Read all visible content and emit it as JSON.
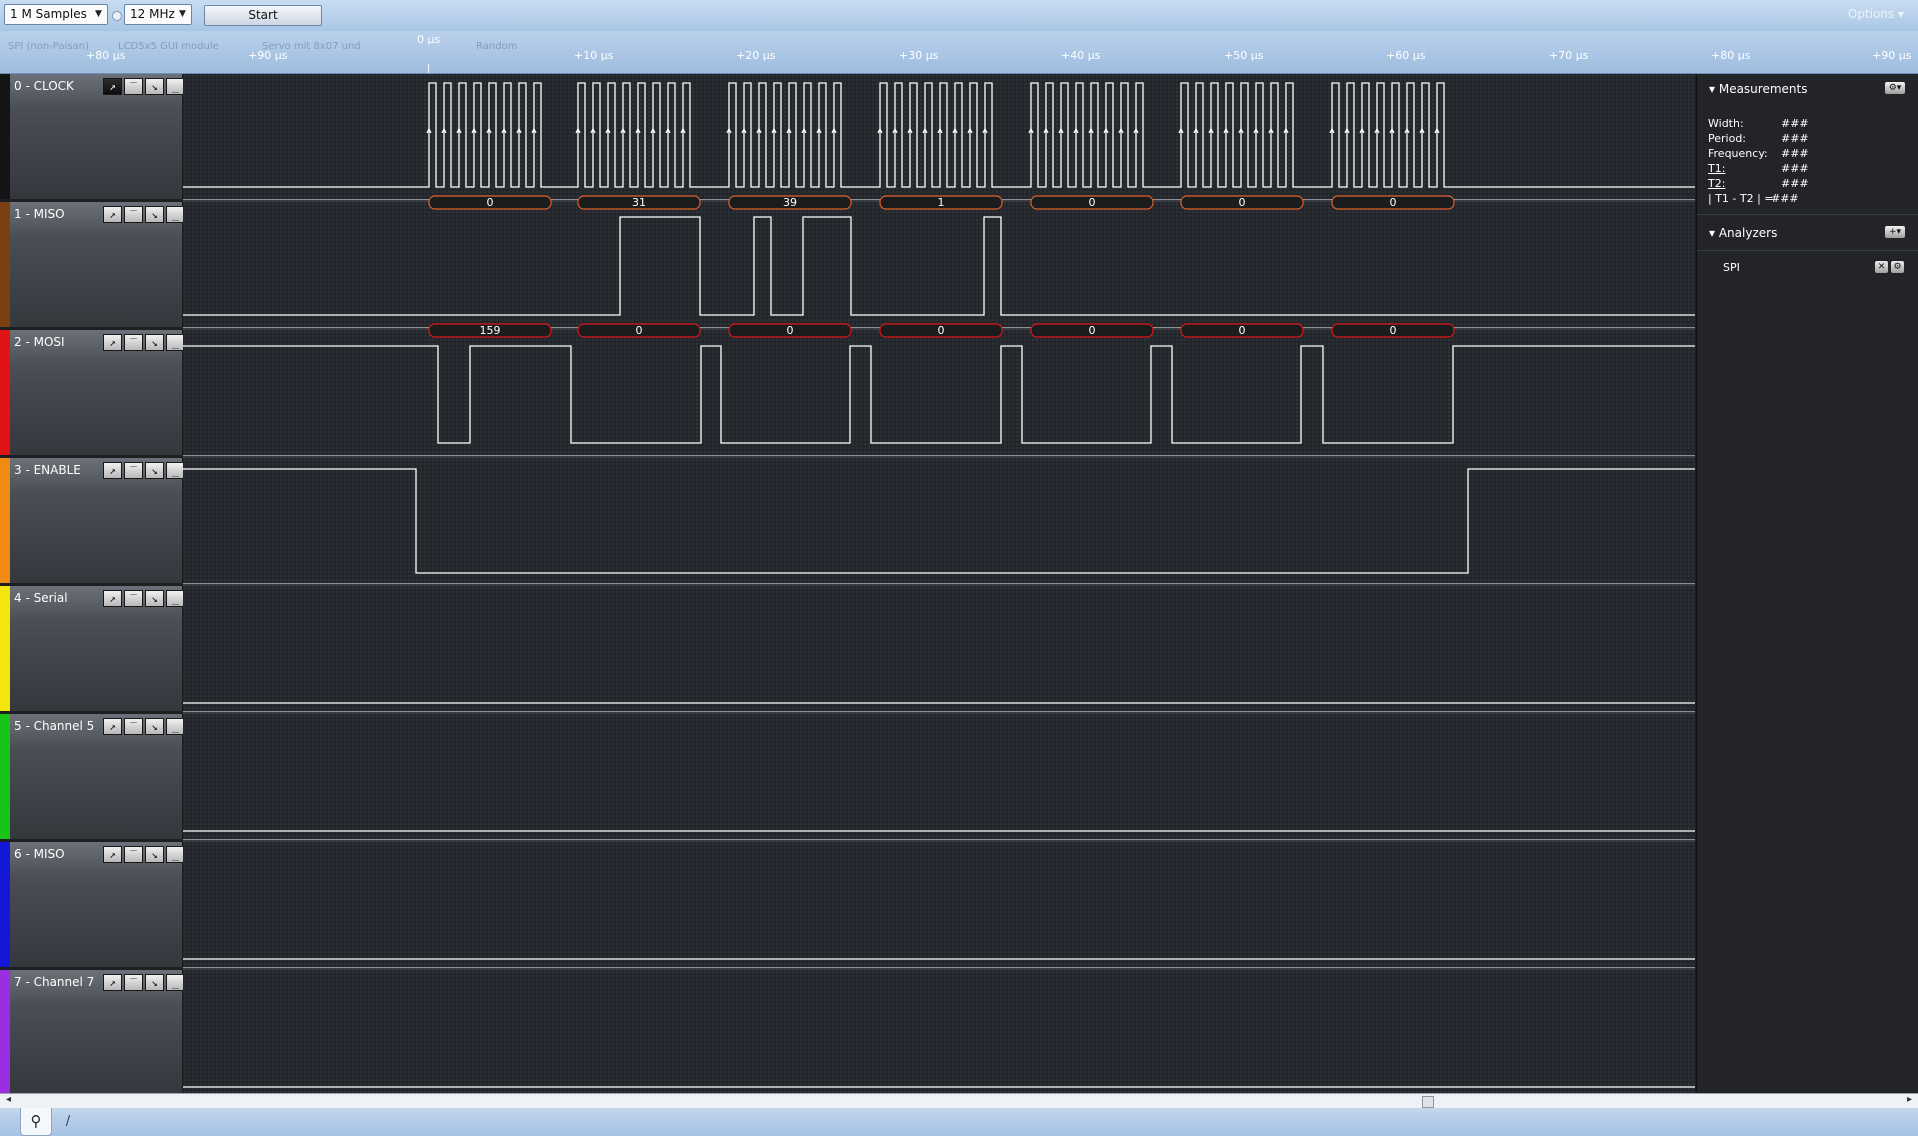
{
  "toolbar": {
    "samples_select": "1 M Samples",
    "rate_select": "12 MHz",
    "start_label": "Start",
    "options_label": "Options ▾"
  },
  "ruler": {
    "zero_label": "0 µs",
    "ticks": [
      "+80 µs",
      "+90 µs",
      "+10 µs",
      "+20 µs",
      "+30 µs",
      "+40 µs",
      "+50 µs",
      "+60 µs",
      "+70 µs",
      "+80 µs",
      "+90 µs"
    ],
    "ghost_labels": [
      "SPI (non-Paisan)",
      "LCD5x5 GUI module",
      "Servo mit 8x07 und",
      "Random"
    ]
  },
  "channels": [
    {
      "name": "0 - CLOCK",
      "color": "#141414"
    },
    {
      "name": "1 - MISO",
      "color": "#7a3f12"
    },
    {
      "name": "2 - MOSI",
      "color": "#e01414"
    },
    {
      "name": "3 - ENABLE",
      "color": "#f08a10"
    },
    {
      "name": "4 - Serial",
      "color": "#f2e60c"
    },
    {
      "name": "5 - Channel 5",
      "color": "#19c418"
    },
    {
      "name": "6 - MISO",
      "color": "#1417d8"
    },
    {
      "name": "7 - Channel 7",
      "color": "#9a2ee0"
    }
  ],
  "trigger_icons": [
    "rising-edge-icon",
    "high-level-icon",
    "falling-edge-icon",
    "low-level-icon"
  ],
  "decoded": {
    "miso_values": [
      "0",
      "31",
      "39",
      "1",
      "0",
      "0",
      "0"
    ],
    "mosi_values": [
      "159",
      "0",
      "0",
      "0",
      "0",
      "0",
      "0"
    ],
    "miso_bubble_color": "#e0602a",
    "mosi_bubble_color": "#e01414"
  },
  "measurements": {
    "title": "Measurements",
    "rows": [
      {
        "label": "Width:",
        "value": "###"
      },
      {
        "label": "Period:",
        "value": "###"
      },
      {
        "label": "Frequency:",
        "value": "###"
      },
      {
        "label": "T1:",
        "value": "###"
      },
      {
        "label": "T2:",
        "value": "###"
      },
      {
        "label": "| T1 - T2 | =",
        "value": "###"
      }
    ]
  },
  "analyzers": {
    "title": "Analyzers",
    "items": [
      "SPI"
    ]
  },
  "colors": {
    "trace": "#ffffff",
    "plot_bg": "#23262a"
  }
}
